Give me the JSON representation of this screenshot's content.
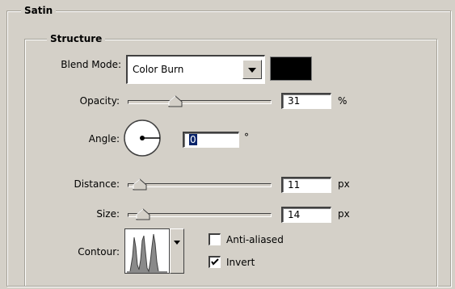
{
  "satin": {
    "title": "Satin"
  },
  "structure": {
    "title": "Structure",
    "blend_mode": {
      "label": "Blend Mode:",
      "value": "Color Burn",
      "color": "#000000"
    },
    "opacity": {
      "label": "Opacity:",
      "value": "31",
      "unit": "%",
      "slider_fraction": 0.31
    },
    "angle": {
      "label": "Angle:",
      "value": "0",
      "unit": "°"
    },
    "distance": {
      "label": "Distance:",
      "value": "11",
      "unit": "px",
      "slider_fraction": 0.04
    },
    "size": {
      "label": "Size:",
      "value": "14",
      "unit": "px",
      "slider_fraction": 0.06
    },
    "contour": {
      "label": "Contour:",
      "icon": "contour-curve-icon"
    },
    "anti_aliased": {
      "label": "Anti-aliased",
      "checked": false
    },
    "invert": {
      "label": "Invert",
      "checked": true
    }
  }
}
